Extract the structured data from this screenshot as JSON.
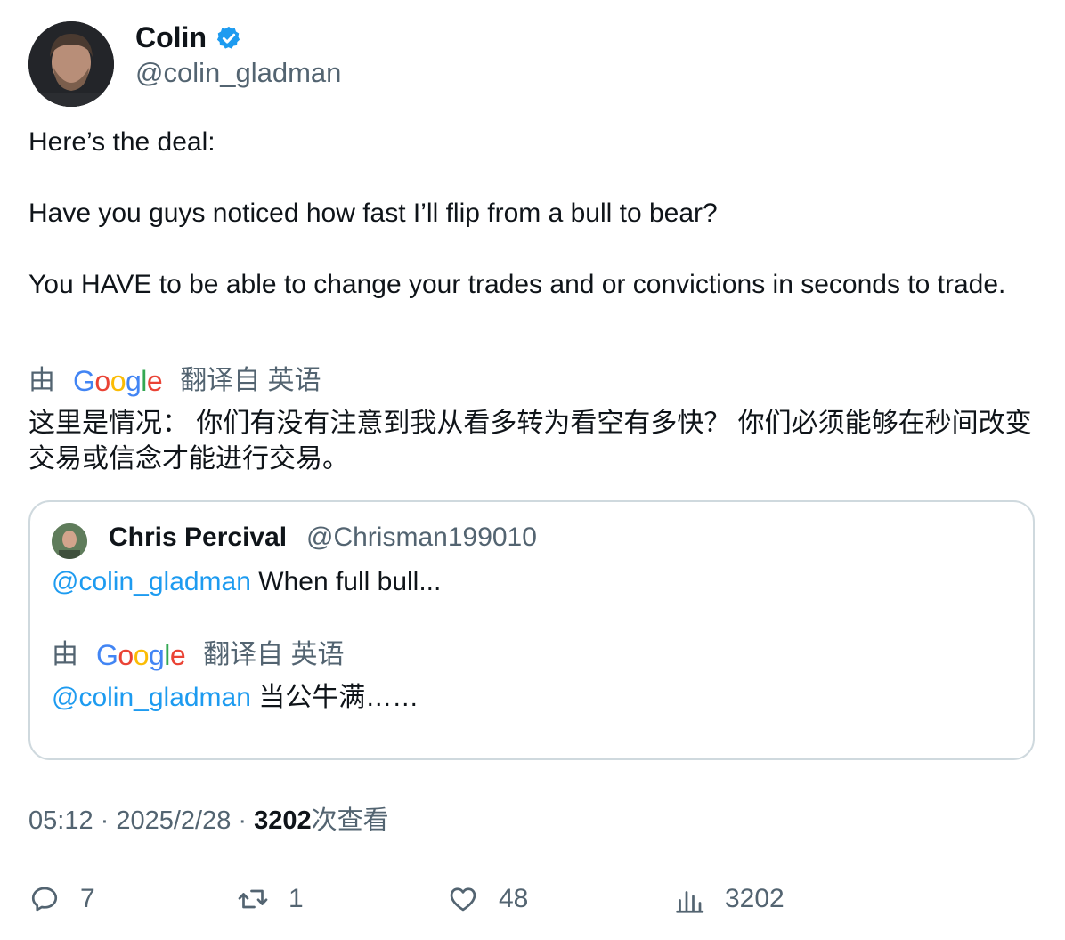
{
  "author": {
    "name": "Colin",
    "handle": "@colin_gladman",
    "verified": true
  },
  "tweet": {
    "text": "Here’s the deal:\n\nHave you guys noticed how fast I’ll flip from a bull to bear?\n\nYou HAVE to be able to change your trades and or convictions in seconds to trade.",
    "translation": {
      "by_label": "由",
      "provider": "Google",
      "translated_from": "翻译自 英语",
      "text": "这里是情况： 你们有没有注意到我从看多转为看空有多快？ 你们必须能够在秒间改变交易或信念才能进行交易。"
    }
  },
  "quote": {
    "name": "Chris Percival",
    "handle": "@Chrisman199010",
    "mention": "@colin_gladman",
    "text": " When full bull...",
    "translation": {
      "by_label": "由",
      "provider": "Google",
      "translated_from": "翻译自 英语",
      "mention": "@colin_gladman",
      "text": " 当公牛满……"
    }
  },
  "meta": {
    "time": "05:12",
    "separator": " · ",
    "date": "2025/2/28",
    "views_count": "3202",
    "views_label": "次查看"
  },
  "actions": {
    "replies": "7",
    "retweets": "1",
    "likes": "48",
    "views": "3202"
  },
  "colors": {
    "accent": "#1d9bf0",
    "secondary_text": "#536471",
    "border": "#cfd9de"
  }
}
